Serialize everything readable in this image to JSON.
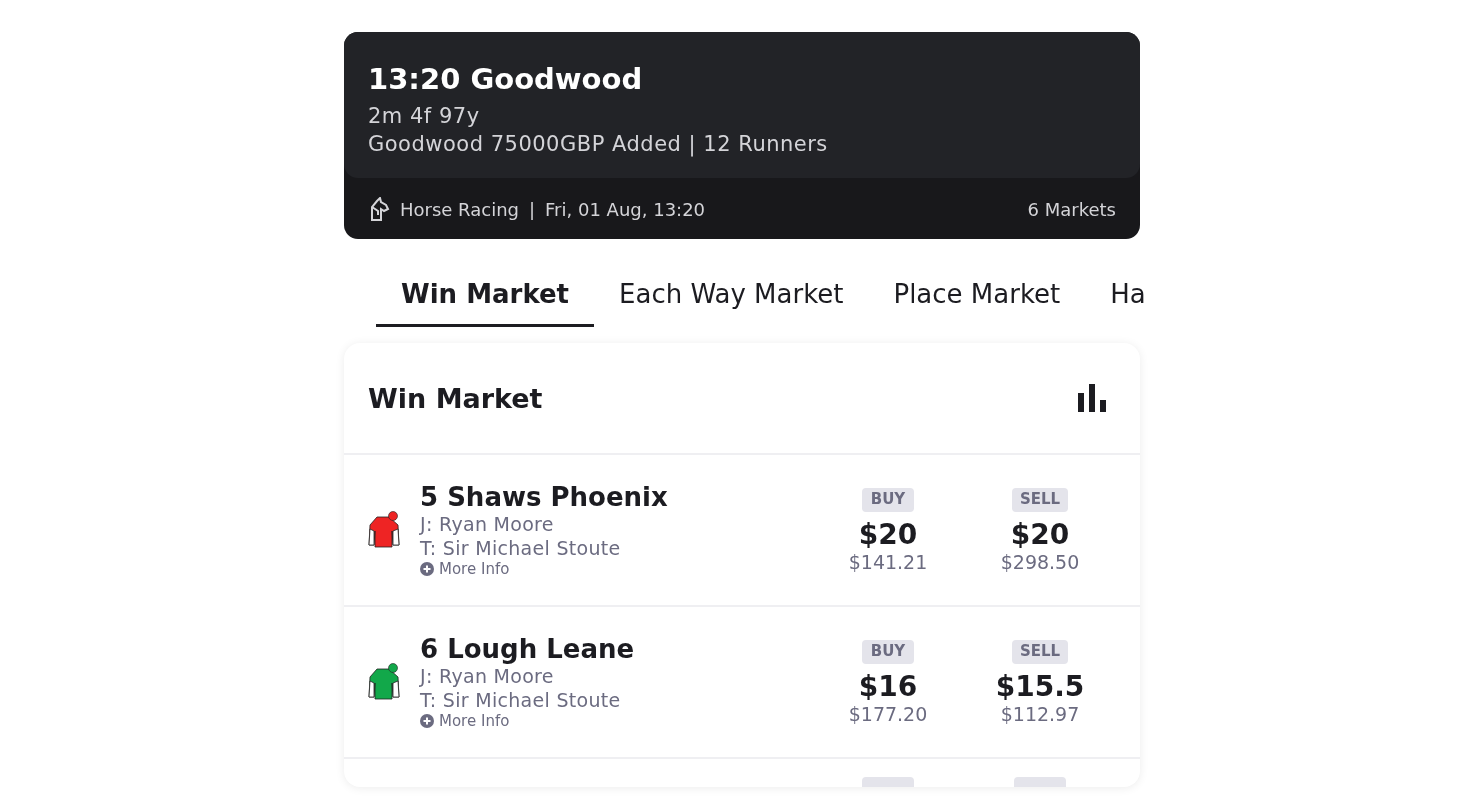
{
  "event": {
    "title": "13:20 Goodwood",
    "distance": "2m 4f 97y",
    "details": "Goodwood 75000GBP Added | 12 Runners",
    "sport": "Horse Racing",
    "separator": "|",
    "datetime": "Fri, 01 Aug, 13:20",
    "markets": "6 Markets"
  },
  "tabs": [
    {
      "label": "Win Market",
      "selected": true
    },
    {
      "label": "Each Way Market",
      "selected": false
    },
    {
      "label": "Place Market",
      "selected": false
    },
    {
      "label": "Ha",
      "selected": false
    }
  ],
  "market": {
    "title": "Win Market",
    "runners": [
      {
        "name": "5 Shaws Phoenix",
        "jockey": "J: Ryan Moore",
        "trainer": "T: Sir Michael Stoute",
        "more": "More Info",
        "color": "#ee2424",
        "buy_label": "BUY",
        "buy_price": "$20",
        "buy_amount": "$141.21",
        "sell_label": "SELL",
        "sell_price": "$20",
        "sell_amount": "$298.50"
      },
      {
        "name": "6 Lough Leane",
        "jockey": "J: Ryan Moore",
        "trainer": "T: Sir Michael Stoute",
        "more": "More Info",
        "color": "#12a84a",
        "buy_label": "BUY",
        "buy_price": "$16",
        "buy_amount": "$177.20",
        "sell_label": "SELL",
        "sell_price": "$15.5",
        "sell_amount": "$112.97"
      }
    ]
  }
}
